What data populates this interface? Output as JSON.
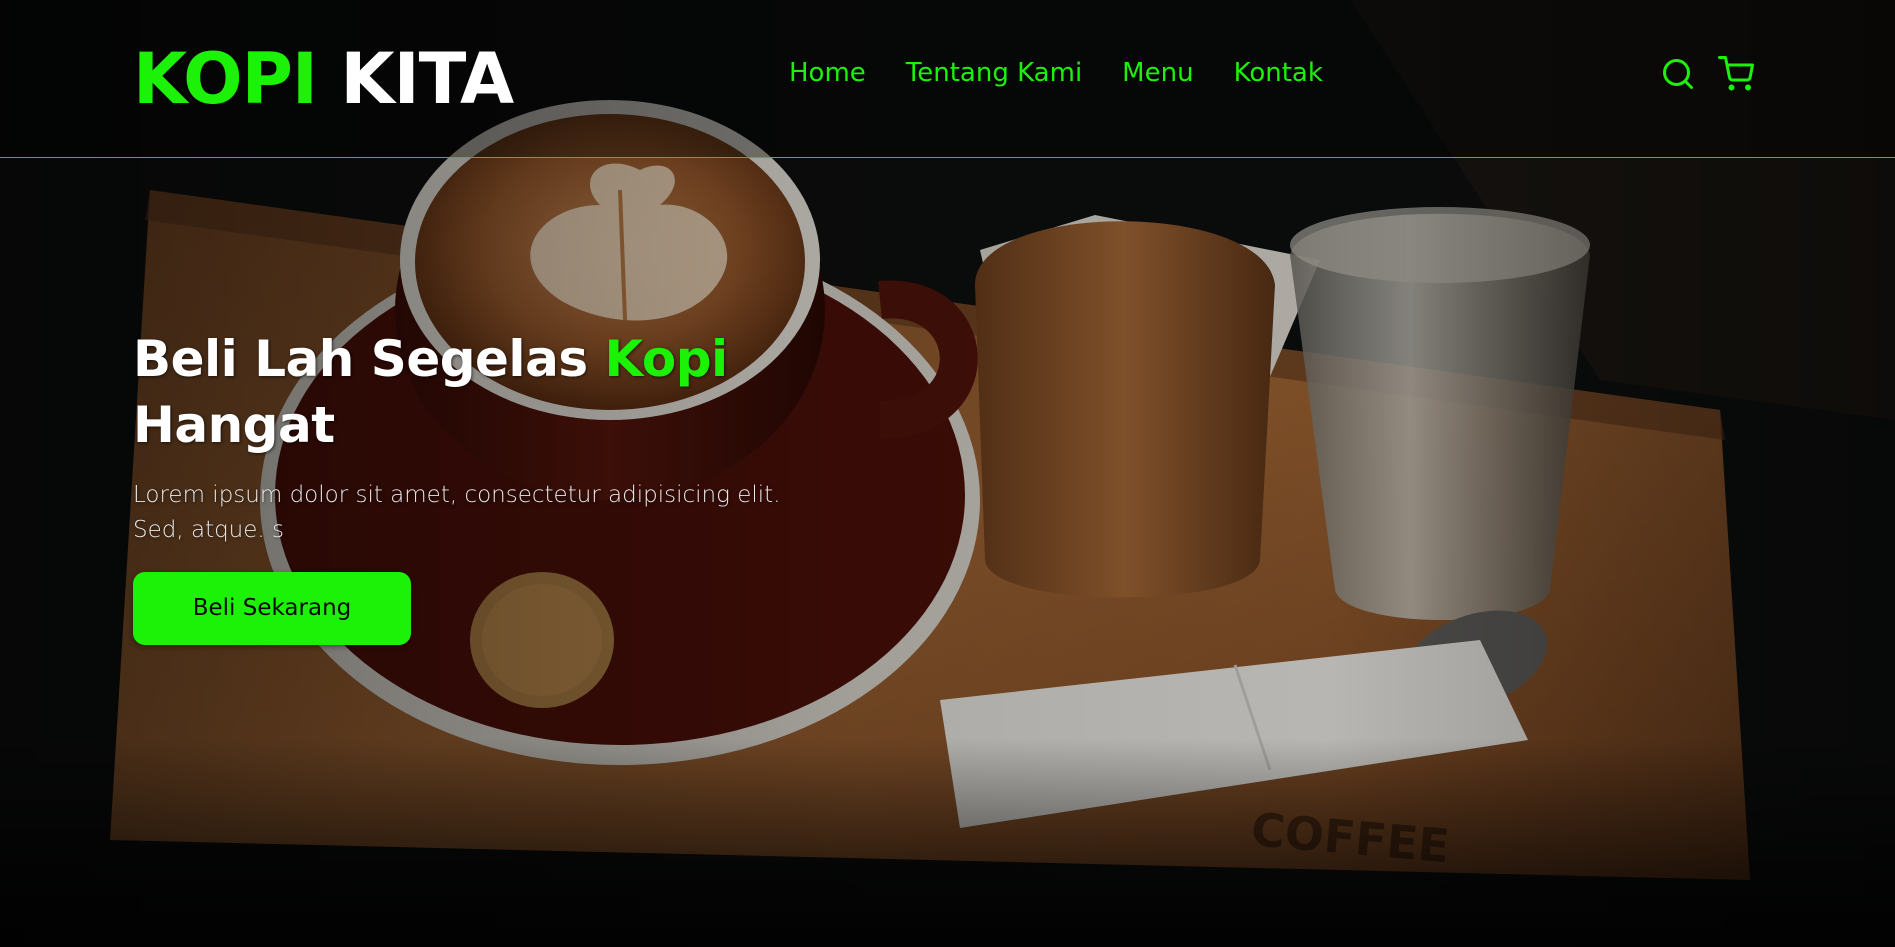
{
  "brand": {
    "logo_accent": "KOPI",
    "logo_plain": "KITA"
  },
  "nav": {
    "links": [
      "Home",
      "Tentang Kami",
      "Menu",
      "Kontak"
    ],
    "icons": [
      "search-icon",
      "shopping-cart-icon"
    ]
  },
  "hero": {
    "title_prefix": "Beli Lah Segelas",
    "title_accent": "Kopi",
    "title_suffix": "Hangat",
    "description": "Lorem ipsum dolor sit amet, consectetur adipisicing elit. Sed, atque. s",
    "cta_label": "Beli Sekarang"
  },
  "colors": {
    "accent": "#1cf207",
    "background": "#0b0c0b",
    "text": "#ffffff"
  }
}
